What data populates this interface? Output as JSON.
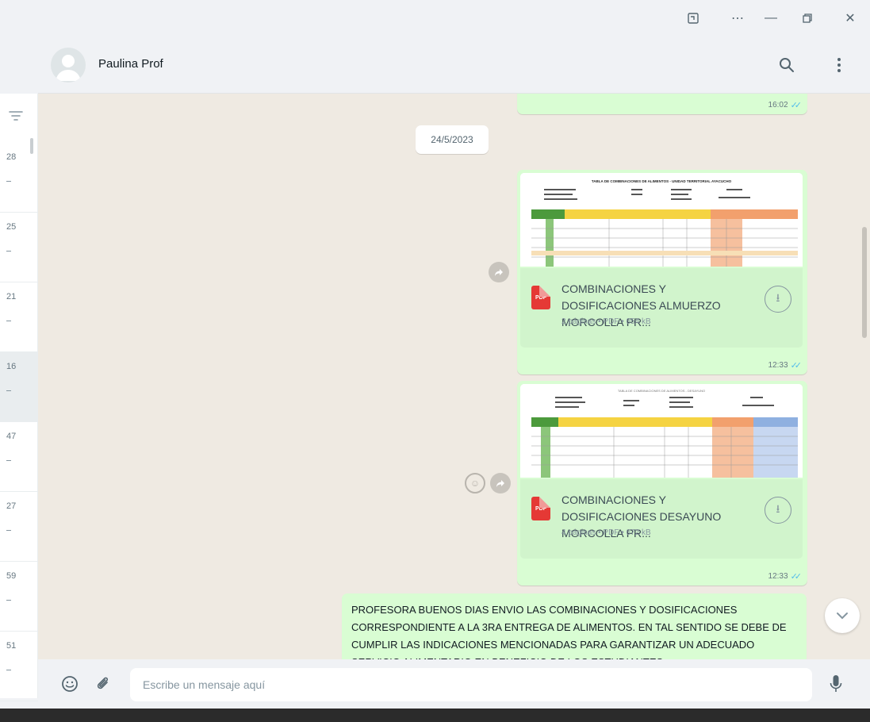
{
  "window": {
    "buttons": [
      "app-icon",
      "more-icon",
      "minimize-icon",
      "restore-icon",
      "close-icon"
    ]
  },
  "sidebar": {
    "items": [
      {
        "time": "28",
        "active": false
      },
      {
        "time": "25",
        "active": false
      },
      {
        "time": "21",
        "active": false
      },
      {
        "time": "16",
        "active": true
      },
      {
        "time": "47",
        "active": false
      },
      {
        "time": "27",
        "active": false
      },
      {
        "time": "59",
        "active": false
      },
      {
        "time": "51",
        "active": false
      }
    ]
  },
  "header": {
    "contact_name": "Paulina Prof"
  },
  "messages": {
    "top_time": "16:02",
    "date_separator": "24/5/2023",
    "documents": [
      {
        "title": "COMBINACIONES Y DOSIFICACIONES ALMUERZO MORCOLLA PR...",
        "meta": "2 páginas • PDF • 654 kB",
        "time": "12:33",
        "preview_heading": "TABLA DE COMBINACIONES DE ALIMENTOS - UNIDAD TERRITORIAL AYACUCHO"
      },
      {
        "title": "COMBINACIONES Y DOSIFICACIONES DESAYUNO MORCOLLA PR...",
        "meta": "4 páginas • PDF • 672 kB",
        "time": "12:33",
        "preview_heading": "TABLA DE COMBINACIONES DE ALIMENTOS - DESAYUNO"
      }
    ],
    "text_message": "PROFESORA BUENOS DIAS ENVIO LAS COMBINACIONES Y DOSIFICACIONES CORRESPONDIENTE  A LA 3RA ENTREGA  DE ALIMENTOS. EN TAL SENTIDO SE DEBE DE CUMPLIR LAS INDICACIONES MENCIONADAS PARA  GARANTIZAR UN ADECUADO SERVICIO ALIMENTARIO EN BENEFICIO DE LOS ESTUDIANTES"
  },
  "composer": {
    "placeholder": "Escribe un mensaje aquí"
  },
  "colors": {
    "outgoing_bubble": "#d9fdd3",
    "chat_background": "#efeae2",
    "panel": "#f0f2f5",
    "read_check": "#53bdeb",
    "pdf_red": "#e53935"
  }
}
